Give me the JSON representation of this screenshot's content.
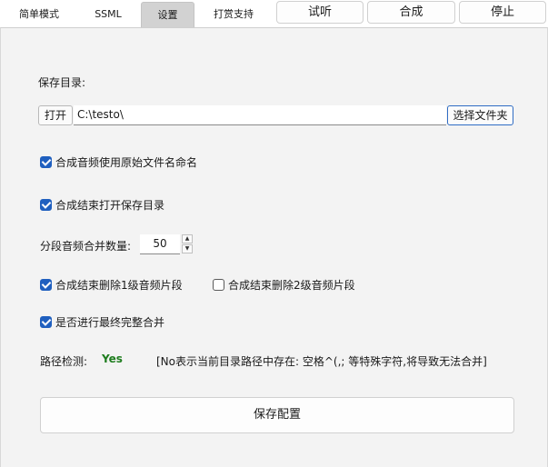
{
  "tabs": [
    {
      "label": "简单模式",
      "active": false
    },
    {
      "label": "SSML",
      "active": false
    },
    {
      "label": "设置",
      "active": true
    },
    {
      "label": "打赏支持",
      "active": false
    }
  ],
  "actions": {
    "listen": "试听",
    "synthesize": "合成",
    "stop": "停止"
  },
  "settings": {
    "save_dir_label": "保存目录:",
    "open_button": "打开",
    "save_dir_value": "C:\\testo\\",
    "choose_folder_button": "选择文件夹",
    "use_original_name": {
      "label": "合成音频使用原始文件名命名",
      "checked": true
    },
    "open_dir_after": {
      "label": "合成结束打开保存目录",
      "checked": true
    },
    "merge_count_label": "分段音频合并数量:",
    "merge_count_value": "50",
    "delete_level1": {
      "label": "合成结束删除1级音频片段",
      "checked": true
    },
    "delete_level2": {
      "label": "合成结束删除2级音频片段",
      "checked": false
    },
    "final_merge": {
      "label": "是否进行最终完整合并",
      "checked": true
    },
    "path_check_label": "路径检测:",
    "path_check_result": "Yes",
    "path_check_note": "[No表示当前目录路径中存在: 空格^(,; 等特殊字符,将导致无法合并]",
    "save_config_button": "保存配置"
  },
  "colors": {
    "accent": "#1f5fbf",
    "status_ok": "#1e7d1e",
    "panel_bg": "#f3f3f3",
    "active_tab": "#d2d2d2"
  }
}
